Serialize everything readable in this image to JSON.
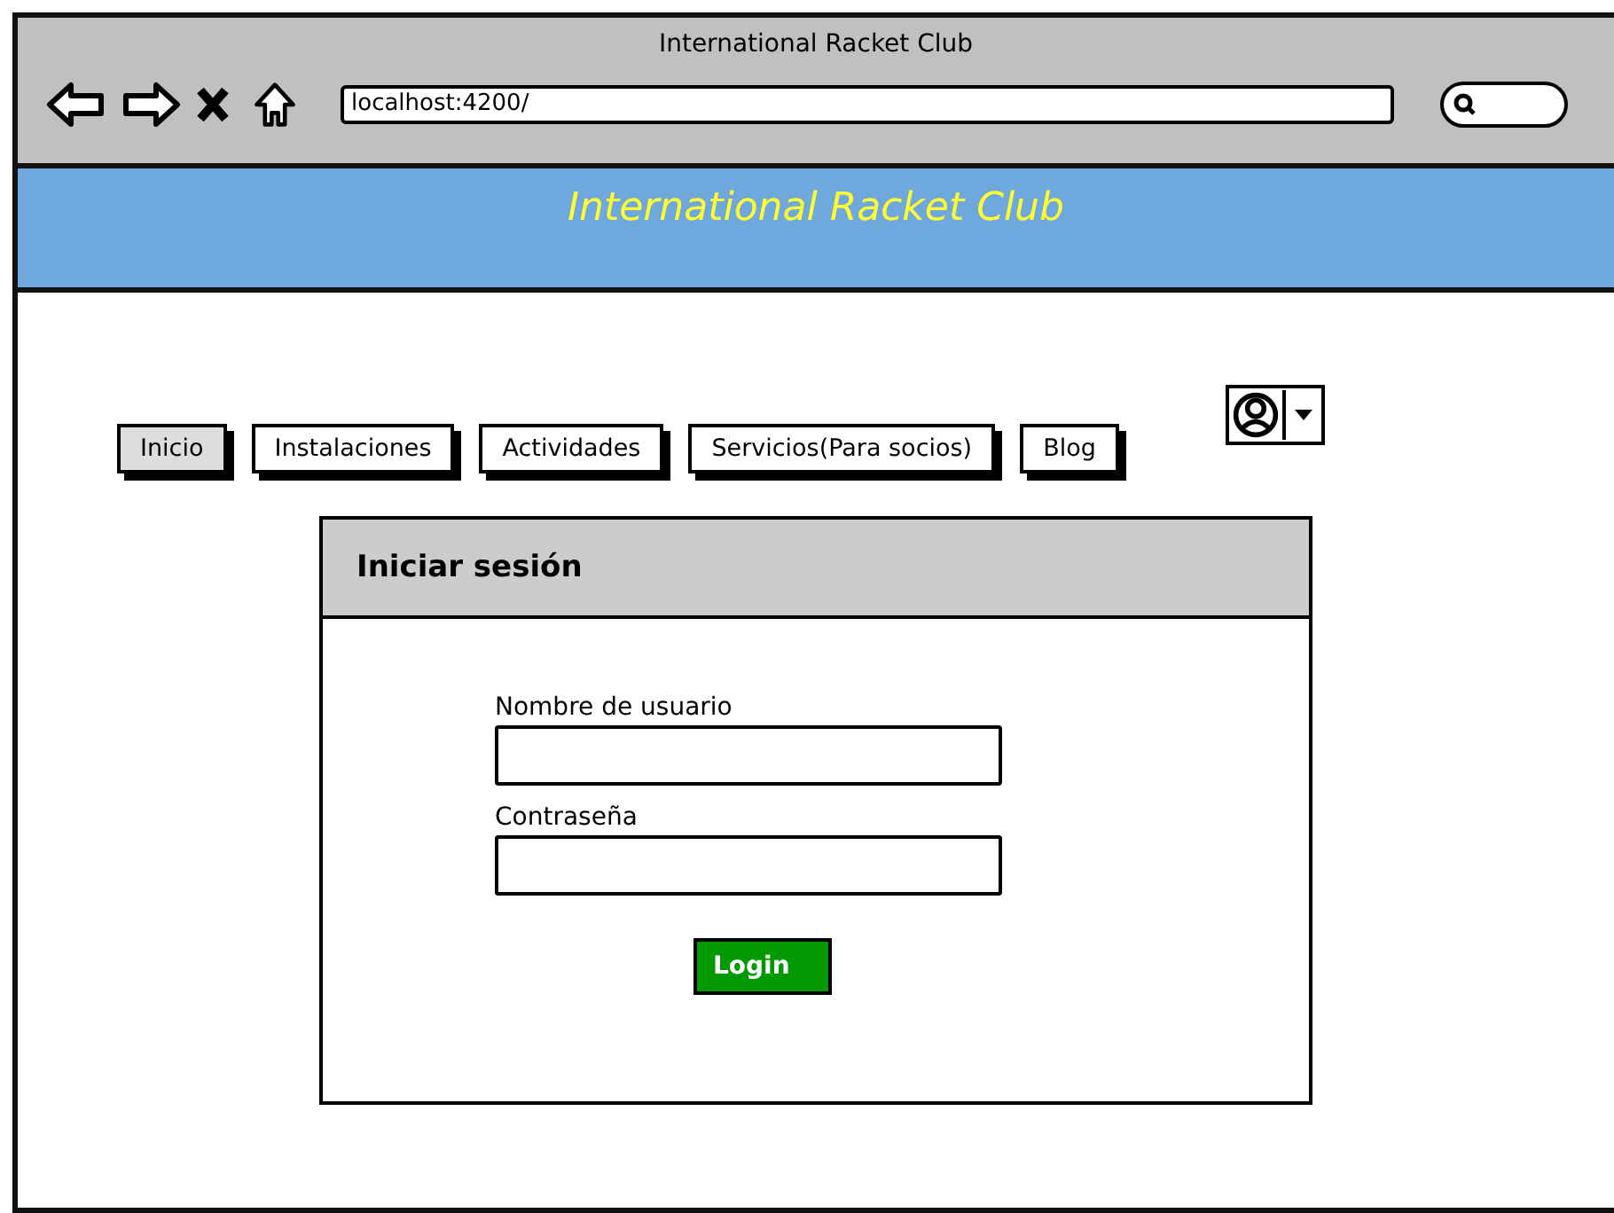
{
  "window": {
    "title": "International Racket Club",
    "address": "localhost:4200/"
  },
  "header": {
    "title": "International Racket Club"
  },
  "nav": [
    {
      "label": "Inicio",
      "selected": true
    },
    {
      "label": "Instalaciones",
      "selected": false
    },
    {
      "label": "Actividades",
      "selected": false
    },
    {
      "label": "Servicios(Para socios)",
      "selected": false
    },
    {
      "label": "Blog",
      "selected": false
    }
  ],
  "login": {
    "title": "Iniciar sesión",
    "fields": [
      {
        "label": "Nombre de usuario"
      },
      {
        "label": "Contraseña"
      }
    ],
    "button": "Login"
  }
}
